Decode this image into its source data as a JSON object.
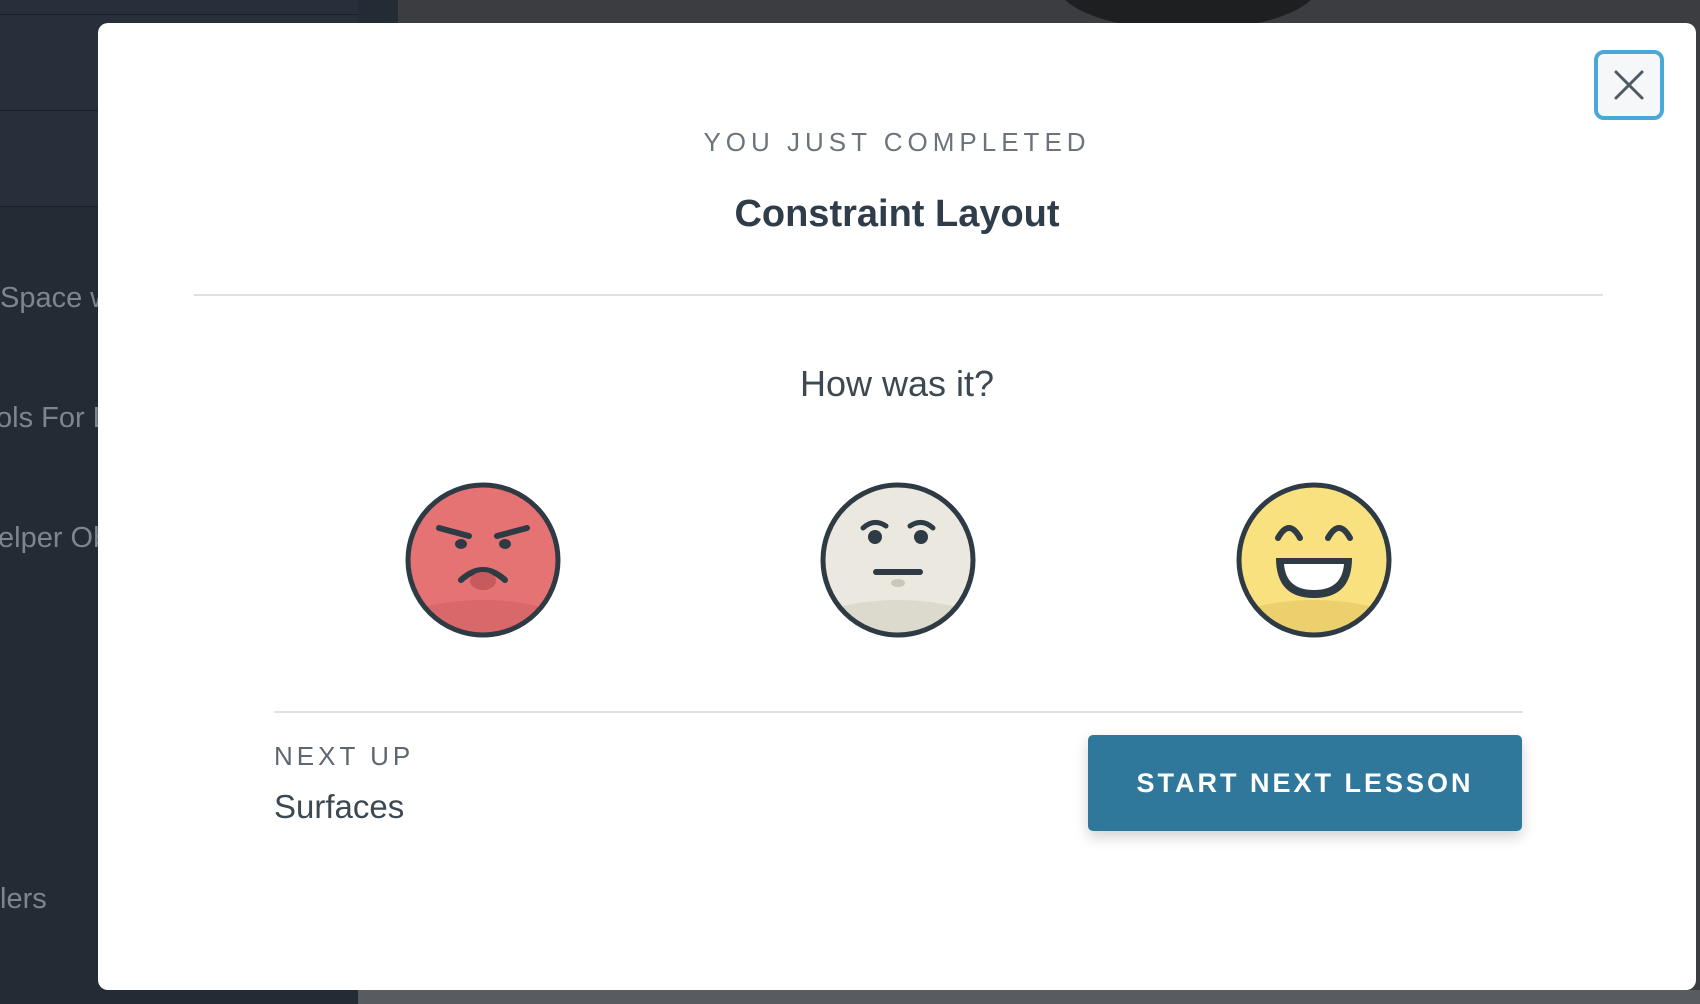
{
  "background": {
    "sidebar_items": [
      "Space w",
      "ols For D",
      "elper Ob",
      "lers"
    ]
  },
  "modal": {
    "eyebrow": "YOU JUST COMPLETED",
    "title": "Constraint Layout",
    "question": "How was it?",
    "ratings": [
      {
        "icon": "angry-face-icon",
        "color": "#e57373"
      },
      {
        "icon": "neutral-face-icon",
        "color": "#ebe9df"
      },
      {
        "icon": "happy-face-icon",
        "color": "#fae17f"
      }
    ],
    "next_up_label": "NEXT UP",
    "next_up_title": "Surfaces",
    "start_button": "START NEXT LESSON",
    "accent_color": "#2f789c",
    "close_icon": "close-icon"
  }
}
